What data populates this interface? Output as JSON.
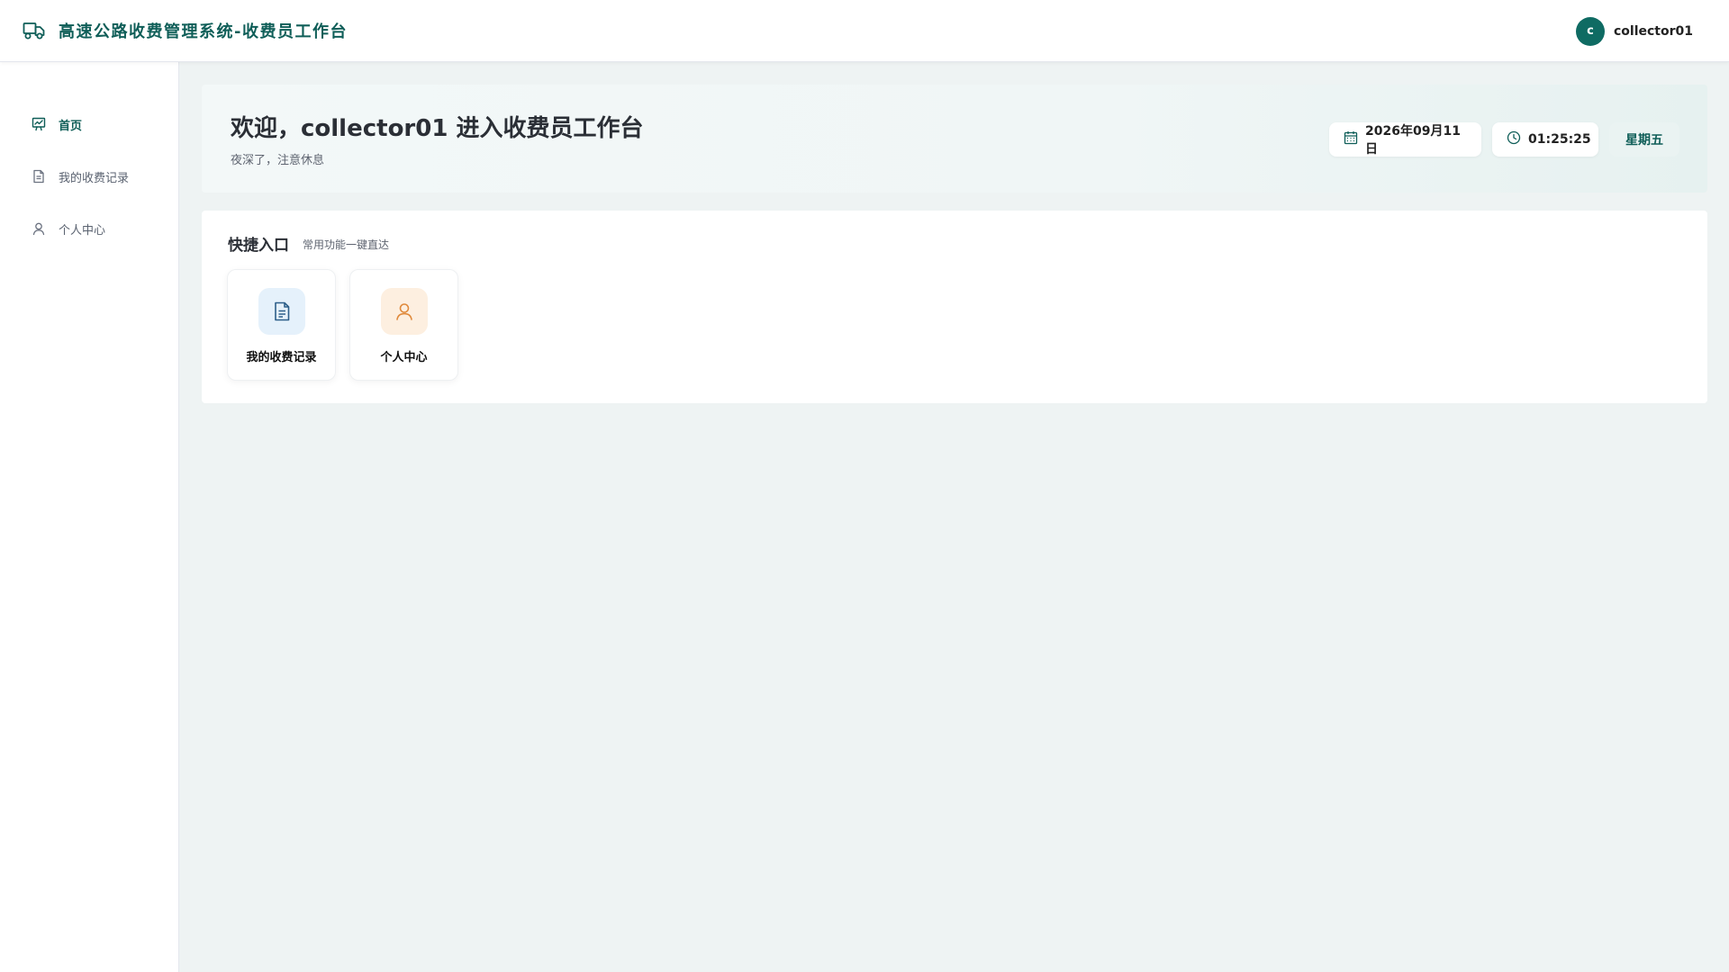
{
  "header": {
    "title": "高速公路收费管理系统-收费员工作台",
    "brand_icon": "truck-icon",
    "user": {
      "avatar_letter": "c",
      "name": "collector01"
    }
  },
  "sidebar": {
    "items": [
      {
        "label": "首页",
        "icon": "dashboard-chart-icon",
        "active": true
      },
      {
        "label": "我的收费记录",
        "icon": "document-icon",
        "active": false
      },
      {
        "label": "个人中心",
        "icon": "user-icon",
        "active": false
      }
    ]
  },
  "welcome": {
    "title": "欢迎，collector01 进入收费员工作台",
    "subtitle": "夜深了，注意休息",
    "date": "2026年09月11日",
    "time": "01:25:25",
    "weekday": "星期五"
  },
  "quick_access": {
    "title": "快捷入口",
    "subtitle": "常用功能一键直达",
    "cards": [
      {
        "label": "我的收费记录",
        "icon": "document-icon",
        "color": "#2d5f8a"
      },
      {
        "label": "个人中心",
        "icon": "user-icon",
        "color": "#e08a3c"
      }
    ]
  },
  "colors": {
    "accent": "#0f5e58",
    "background": "#eef3f3"
  }
}
